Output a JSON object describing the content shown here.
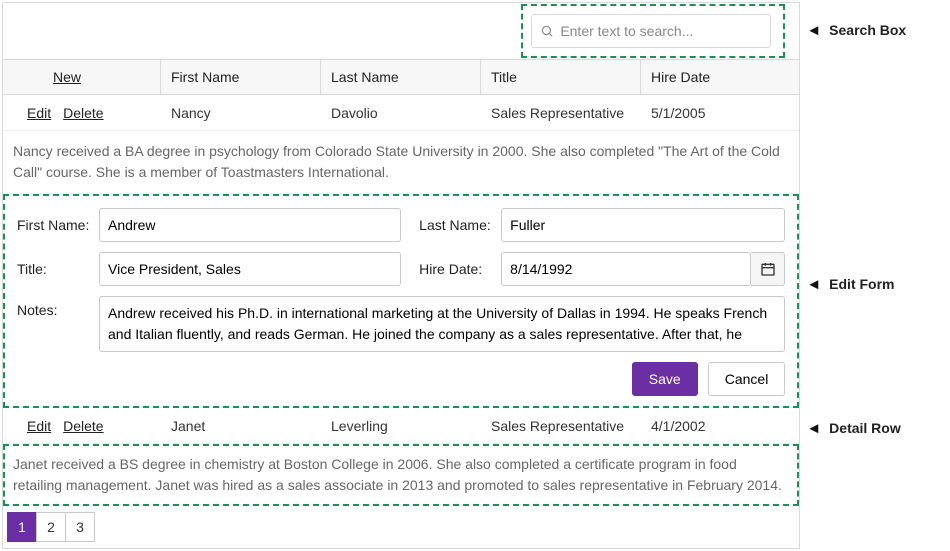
{
  "search": {
    "placeholder": "Enter text to search..."
  },
  "columns": {
    "new": "New",
    "first": "First Name",
    "last": "Last Name",
    "title": "Title",
    "hire": "Hire Date"
  },
  "commands": {
    "edit": "Edit",
    "delete": "Delete"
  },
  "rows": {
    "r0": {
      "first": "Nancy",
      "last": "Davolio",
      "title": "Sales Representative",
      "hire": "5/1/2005"
    },
    "r2": {
      "first": "Janet",
      "last": "Leverling",
      "title": "Sales Representative",
      "hire": "4/1/2002"
    }
  },
  "details": {
    "nancy": "Nancy received a BA degree in psychology from Colorado State University in 2000. She also completed \"The Art of the Cold Call\" course. She is a member of Toastmasters International.",
    "janet": "Janet received a BS degree in chemistry at Boston College in 2006. She also completed a certificate program in food retailing management. Janet was hired as a sales associate in 2013 and promoted to sales representative in February 2014."
  },
  "form": {
    "labels": {
      "first": "First Name:",
      "last": "Last Name:",
      "title": "Title:",
      "hire": "Hire Date:",
      "notes": "Notes:"
    },
    "values": {
      "first": "Andrew",
      "last": "Fuller",
      "title": "Vice President, Sales",
      "hire": "8/14/1992",
      "notes": "Andrew received his Ph.D. in international marketing at the University of Dallas in 1994. He speaks French and Italian fluently, and reads German. He joined the company as a sales representative. After that, he"
    },
    "buttons": {
      "save": "Save",
      "cancel": "Cancel"
    }
  },
  "pager": {
    "p1": "1",
    "p2": "2",
    "p3": "3"
  },
  "callouts": {
    "search": "Search Box",
    "form": "Edit Form",
    "detail": "Detail Row"
  }
}
